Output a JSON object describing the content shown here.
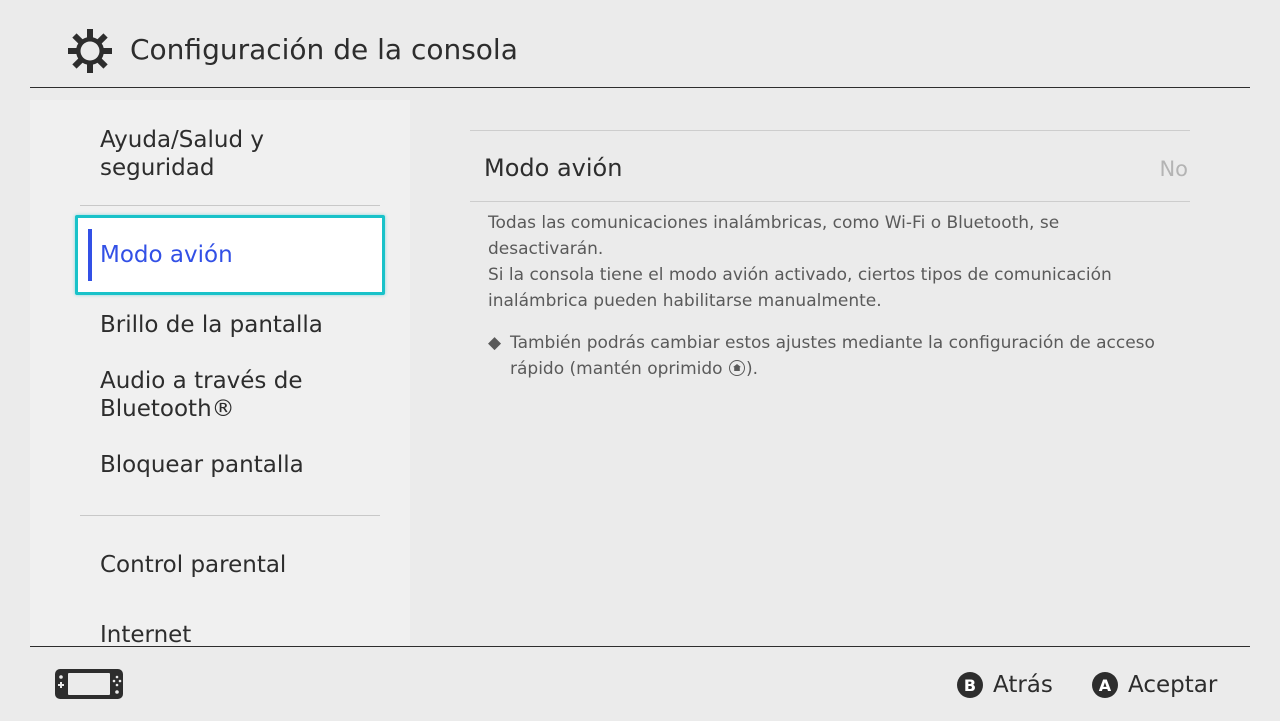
{
  "header": {
    "title": "Configuración de la consola",
    "icon": "gear-icon"
  },
  "sidebar": {
    "items": [
      {
        "label_line1": "Ayuda/Salud y",
        "label_line2": "seguridad"
      },
      {
        "label": "Modo avión",
        "selected": true
      },
      {
        "label": "Brillo de la pantalla"
      },
      {
        "label_line1": "Audio a través de",
        "label_line2": "Bluetooth®"
      },
      {
        "label": "Bloquear pantalla"
      },
      {
        "label": "Control parental"
      },
      {
        "label": "Internet"
      }
    ]
  },
  "main": {
    "setting_name": "Modo avión",
    "setting_value": "No",
    "description_line1": "Todas las comunicaciones inalámbricas, como Wi-Fi o Bluetooth, se desactivarán.",
    "description_line2": "Si la consola tiene el modo avión activado, ciertos tipos de comunicación inalámbrica pueden habilitarse manualmente.",
    "note_bullet": "◆",
    "note_text_before": "También podrás cambiar estos ajustes mediante la configuración de acceso rápido (mantén oprimido ",
    "note_text_after": ")."
  },
  "footer": {
    "back_button_glyph": "B",
    "back_label": "Atrás",
    "accept_button_glyph": "A",
    "accept_label": "Aceptar"
  },
  "colors": {
    "accent_cyan": "#18c2c9",
    "selected_text_blue": "#3250e6",
    "background": "#ebebeb",
    "sidebar_bg": "#f0f0f0"
  }
}
